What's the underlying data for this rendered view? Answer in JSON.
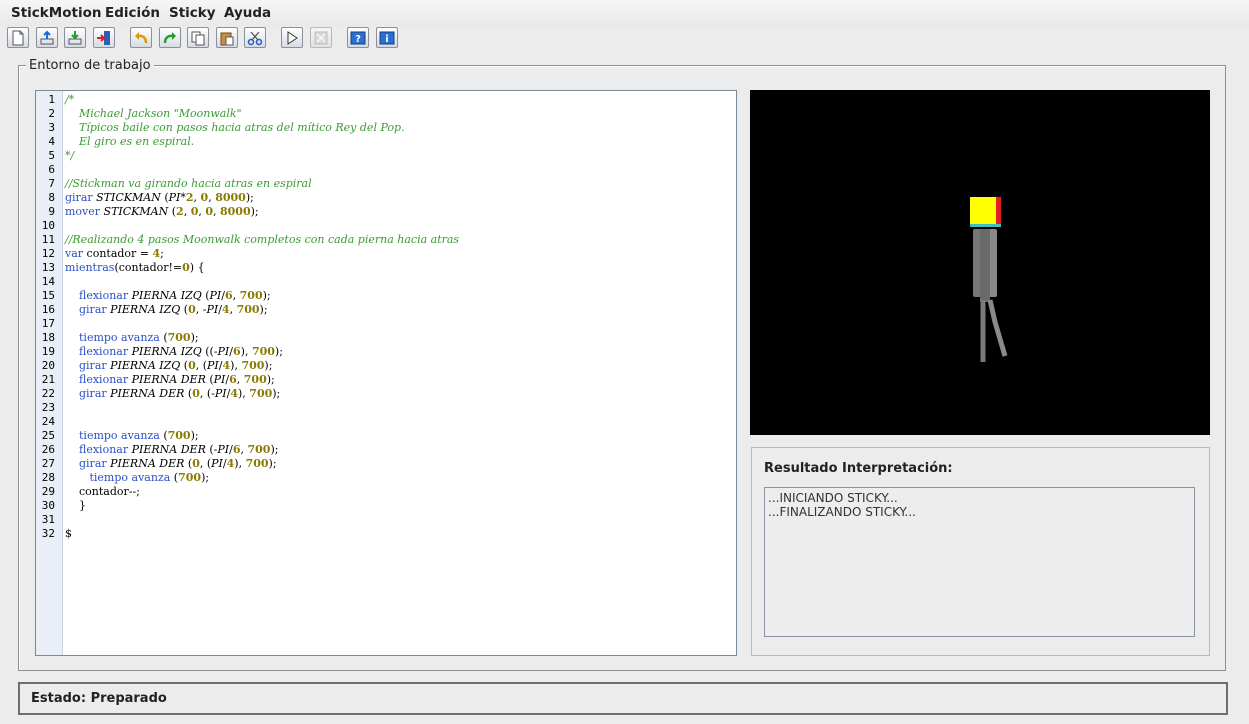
{
  "menu": [
    "StickMotion",
    "Edición",
    "Sticky",
    "Ayuda"
  ],
  "toolbar": {
    "buttons": [
      "new-file-icon",
      "open-file-icon",
      "save-file-icon",
      "exit-icon",
      "undo-icon",
      "redo-icon",
      "copy-icon",
      "paste-icon",
      "cut-icon",
      "run-icon",
      "stop-icon",
      "help-icon",
      "info-icon"
    ]
  },
  "workspace": {
    "title": "Entorno de trabajo"
  },
  "editor": {
    "line_numbers": [
      "1",
      "2",
      "3",
      "4",
      "5",
      "6",
      "7",
      "8",
      "9",
      "10",
      "11",
      "12",
      "13",
      "14",
      "15",
      "16",
      "17",
      "18",
      "19",
      "20",
      "21",
      "22",
      "23",
      "24",
      "25",
      "26",
      "27",
      "28",
      "29",
      "30",
      "31",
      "32"
    ],
    "lines": [
      [
        [
          "c",
          "/*"
        ]
      ],
      [
        [
          "c",
          "    Michael Jackson \"Moonwalk\""
        ]
      ],
      [
        [
          "c",
          "    Típicos baile con pasos hacia atras del mítico Rey del Pop."
        ]
      ],
      [
        [
          "c",
          "    El giro es en espiral."
        ]
      ],
      [
        [
          "c",
          "*/"
        ]
      ],
      [],
      [
        [
          "c",
          "//Stickman va girando hacia atras en espiral"
        ]
      ],
      [
        [
          "k",
          "girar "
        ],
        [
          "i",
          "STICKMAN"
        ],
        [
          "p",
          " ("
        ],
        [
          "i",
          "PI"
        ],
        [
          "p",
          "*"
        ],
        [
          "n",
          "2"
        ],
        [
          "p",
          ", "
        ],
        [
          "n",
          "0"
        ],
        [
          "p",
          ", "
        ],
        [
          "n",
          "8000"
        ],
        [
          "p",
          ");"
        ]
      ],
      [
        [
          "k",
          "mover "
        ],
        [
          "i",
          "STICKMAN"
        ],
        [
          "p",
          " ("
        ],
        [
          "n",
          "2"
        ],
        [
          "p",
          ", "
        ],
        [
          "n",
          "0"
        ],
        [
          "p",
          ", "
        ],
        [
          "n",
          "0"
        ],
        [
          "p",
          ", "
        ],
        [
          "n",
          "8000"
        ],
        [
          "p",
          ");"
        ]
      ],
      [],
      [
        [
          "c",
          "//Realizando 4 pasos Moonwalk completos con cada pierna hacia atras"
        ]
      ],
      [
        [
          "k",
          "var "
        ],
        [
          "p",
          "contador = "
        ],
        [
          "n",
          "4"
        ],
        [
          "p",
          ";"
        ]
      ],
      [
        [
          "k",
          "mientras"
        ],
        [
          "p",
          "(contador!="
        ],
        [
          "n",
          "0"
        ],
        [
          "p",
          ") {"
        ]
      ],
      [],
      [
        [
          "p",
          "    "
        ],
        [
          "k",
          "flexionar "
        ],
        [
          "i",
          "PIERNA IZQ"
        ],
        [
          "p",
          " ("
        ],
        [
          "i",
          "PI"
        ],
        [
          "p",
          "/"
        ],
        [
          "n",
          "6"
        ],
        [
          "p",
          ", "
        ],
        [
          "n",
          "700"
        ],
        [
          "p",
          ");"
        ]
      ],
      [
        [
          "p",
          "    "
        ],
        [
          "k",
          "girar "
        ],
        [
          "i",
          "PIERNA IZQ"
        ],
        [
          "p",
          " ("
        ],
        [
          "n",
          "0"
        ],
        [
          "p",
          ", -"
        ],
        [
          "i",
          "PI"
        ],
        [
          "p",
          "/"
        ],
        [
          "n",
          "4"
        ],
        [
          "p",
          ", "
        ],
        [
          "n",
          "700"
        ],
        [
          "p",
          ");"
        ]
      ],
      [],
      [
        [
          "p",
          "    "
        ],
        [
          "k",
          "tiempo avanza "
        ],
        [
          "p",
          "("
        ],
        [
          "n",
          "700"
        ],
        [
          "p",
          ");"
        ]
      ],
      [
        [
          "p",
          "    "
        ],
        [
          "k",
          "flexionar "
        ],
        [
          "i",
          "PIERNA IZQ"
        ],
        [
          "p",
          " ((-"
        ],
        [
          "i",
          "PI"
        ],
        [
          "p",
          "/"
        ],
        [
          "n",
          "6"
        ],
        [
          "p",
          "), "
        ],
        [
          "n",
          "700"
        ],
        [
          "p",
          ");"
        ]
      ],
      [
        [
          "p",
          "    "
        ],
        [
          "k",
          "girar "
        ],
        [
          "i",
          "PIERNA IZQ"
        ],
        [
          "p",
          " ("
        ],
        [
          "n",
          "0"
        ],
        [
          "p",
          ", ("
        ],
        [
          "i",
          "PI"
        ],
        [
          "p",
          "/"
        ],
        [
          "n",
          "4"
        ],
        [
          "p",
          "), "
        ],
        [
          "n",
          "700"
        ],
        [
          "p",
          ");"
        ]
      ],
      [
        [
          "p",
          "    "
        ],
        [
          "k",
          "flexionar "
        ],
        [
          "i",
          "PIERNA DER"
        ],
        [
          "p",
          " ("
        ],
        [
          "i",
          "PI"
        ],
        [
          "p",
          "/"
        ],
        [
          "n",
          "6"
        ],
        [
          "p",
          ", "
        ],
        [
          "n",
          "700"
        ],
        [
          "p",
          ");"
        ]
      ],
      [
        [
          "p",
          "    "
        ],
        [
          "k",
          "girar "
        ],
        [
          "i",
          "PIERNA DER"
        ],
        [
          "p",
          " ("
        ],
        [
          "n",
          "0"
        ],
        [
          "p",
          ", (-"
        ],
        [
          "i",
          "PI"
        ],
        [
          "p",
          "/"
        ],
        [
          "n",
          "4"
        ],
        [
          "p",
          "), "
        ],
        [
          "n",
          "700"
        ],
        [
          "p",
          ");"
        ]
      ],
      [],
      [],
      [
        [
          "p",
          "    "
        ],
        [
          "k",
          "tiempo avanza "
        ],
        [
          "p",
          "("
        ],
        [
          "n",
          "700"
        ],
        [
          "p",
          ");"
        ]
      ],
      [
        [
          "p",
          "    "
        ],
        [
          "k",
          "flexionar "
        ],
        [
          "i",
          "PIERNA DER"
        ],
        [
          "p",
          " (-"
        ],
        [
          "i",
          "PI"
        ],
        [
          "p",
          "/"
        ],
        [
          "n",
          "6"
        ],
        [
          "p",
          ", "
        ],
        [
          "n",
          "700"
        ],
        [
          "p",
          ");"
        ]
      ],
      [
        [
          "p",
          "    "
        ],
        [
          "k",
          "girar "
        ],
        [
          "i",
          "PIERNA DER"
        ],
        [
          "p",
          " ("
        ],
        [
          "n",
          "0"
        ],
        [
          "p",
          ", ("
        ],
        [
          "i",
          "PI"
        ],
        [
          "p",
          "/"
        ],
        [
          "n",
          "4"
        ],
        [
          "p",
          "), "
        ],
        [
          "n",
          "700"
        ],
        [
          "p",
          ");"
        ]
      ],
      [
        [
          "p",
          "       "
        ],
        [
          "k",
          "tiempo avanza "
        ],
        [
          "p",
          "("
        ],
        [
          "n",
          "700"
        ],
        [
          "p",
          ");"
        ]
      ],
      [
        [
          "p",
          "    contador--;"
        ]
      ],
      [
        [
          "p",
          "    }"
        ]
      ],
      [],
      [
        [
          "p",
          "$"
        ]
      ]
    ]
  },
  "result": {
    "title": "Resultado Interpretación:",
    "lines": [
      "...INICIANDO STICKY...",
      "...FINALIZANDO STICKY..."
    ]
  },
  "status": {
    "text": "Estado: Preparado"
  }
}
